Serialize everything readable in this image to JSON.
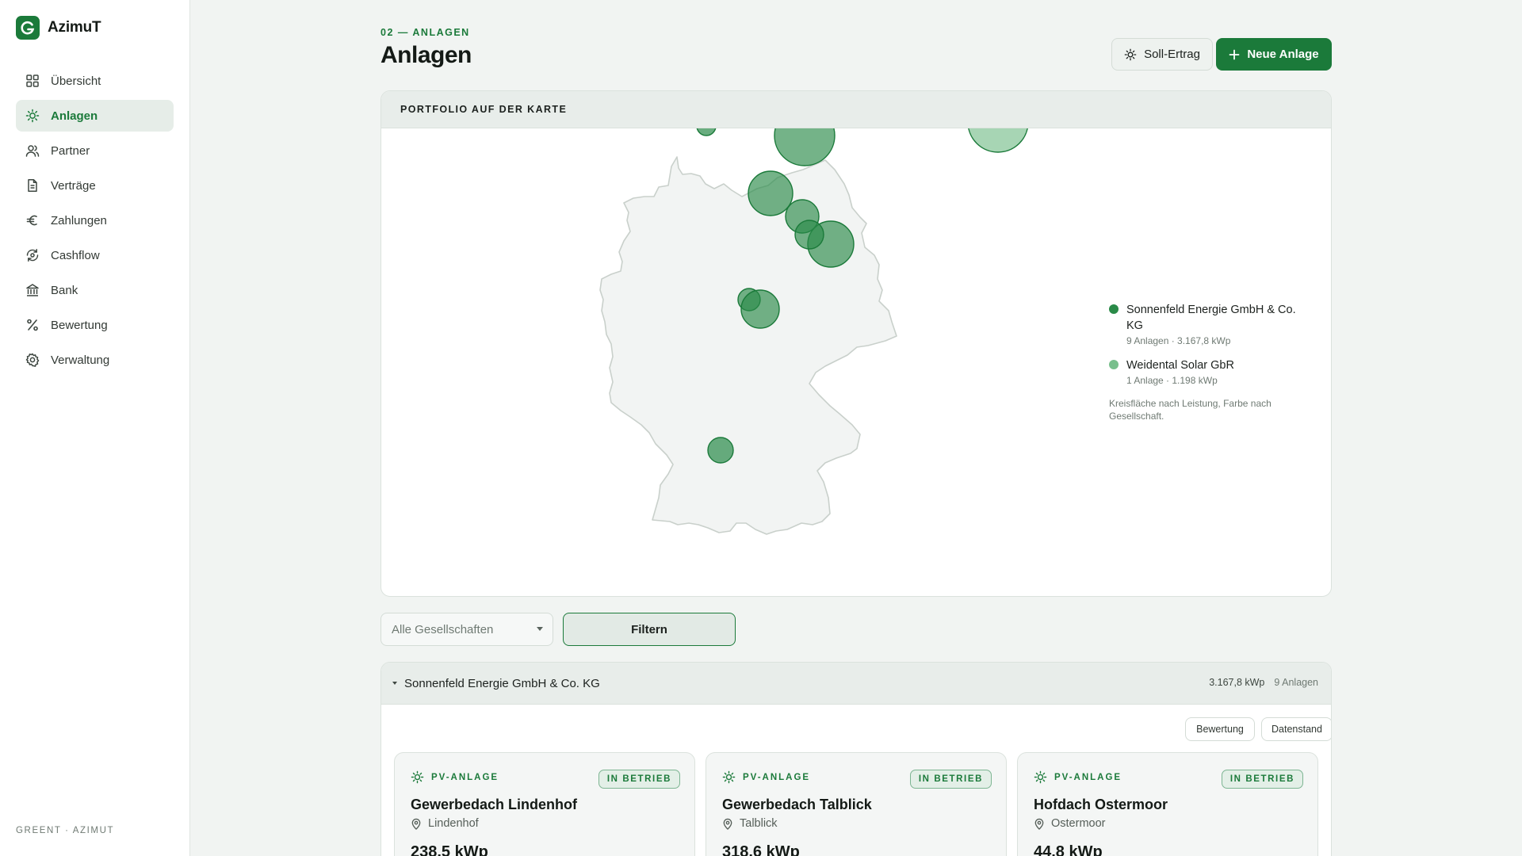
{
  "app": {
    "name": "AzimuT",
    "footer": "GREENT · AZIMUT"
  },
  "sidebar": {
    "items": [
      {
        "label": "Übersicht",
        "icon": "grid-icon",
        "active": false
      },
      {
        "label": "Anlagen",
        "icon": "sun-icon",
        "active": true
      },
      {
        "label": "Partner",
        "icon": "users-icon",
        "active": false
      },
      {
        "label": "Verträge",
        "icon": "document-icon",
        "active": false
      },
      {
        "label": "Zahlungen",
        "icon": "euro-icon",
        "active": false
      },
      {
        "label": "Cashflow",
        "icon": "cashflow-icon",
        "active": false
      },
      {
        "label": "Bank",
        "icon": "bank-icon",
        "active": false
      },
      {
        "label": "Bewertung",
        "icon": "percent-icon",
        "active": false
      },
      {
        "label": "Verwaltung",
        "icon": "gear-icon",
        "active": false
      }
    ]
  },
  "header": {
    "eyebrow": "02 — ANLAGEN",
    "title": "Anlagen",
    "soll_label": "Soll-Ertrag",
    "neu_label": "Neue Anlage"
  },
  "map": {
    "title": "PORTFOLIO AUF DER KARTE",
    "legend": [
      {
        "name": "Sonnenfeld Energie GmbH & Co. KG",
        "meta": "9 Anlagen · 3.167,8 kWp",
        "color": "#2a8a48"
      },
      {
        "name": "Weidental Solar GbR",
        "meta": "1 Anlage · 1.198 kWp",
        "color": "#78bf8c"
      }
    ],
    "note": "Kreisfläche nach Leistung, Farbe nach Gesellschaft."
  },
  "filters": {
    "gesellschaft_placeholder": "Alle Gesellschaften",
    "filter_label": "Filtern"
  },
  "group": {
    "name": "Sonnenfeld Energie GmbH & Co. KG",
    "kwp": "3.167,8 kWp",
    "count": "9 Anlagen",
    "chips": [
      "Bewertung",
      "Datenstand"
    ],
    "cards": [
      {
        "type": "PV-ANLAGE",
        "status": "IN BETRIEB",
        "title": "Gewerbedach Lindenhof",
        "location": "Lindenhof",
        "kwp": "238,5 kWp"
      },
      {
        "type": "PV-ANLAGE",
        "status": "IN BETRIEB",
        "title": "Gewerbedach Talblick",
        "location": "Talblick",
        "kwp": "318,6 kWp"
      },
      {
        "type": "PV-ANLAGE",
        "status": "IN BETRIEB",
        "title": "Hofdach Ostermoor",
        "location": "Ostermoor",
        "kwp": "44,8 kWp"
      }
    ]
  },
  "colors": {
    "accent": "#1b7a3a",
    "series_a": "#2a8a48",
    "series_b": "#78bf8c"
  }
}
